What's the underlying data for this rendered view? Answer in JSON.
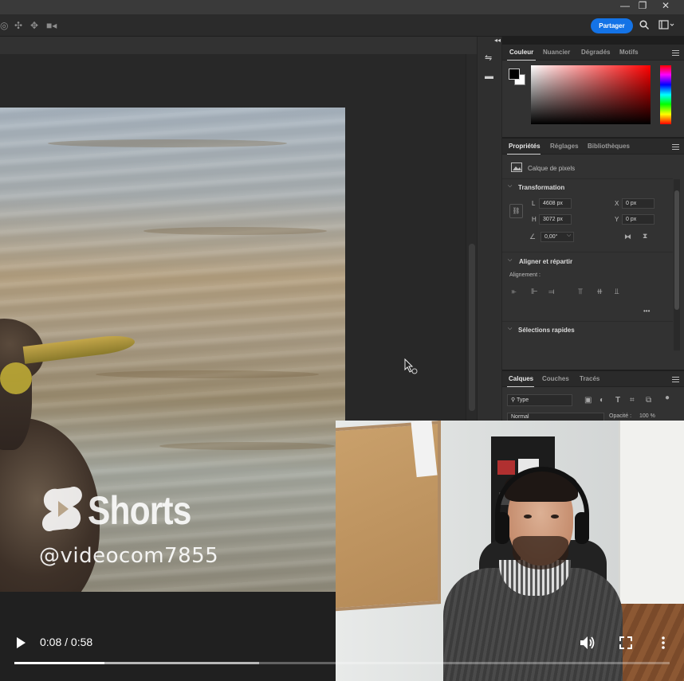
{
  "window": {
    "controls": [
      "—",
      "❐",
      "✕"
    ]
  },
  "header": {
    "share_label": "Partager"
  },
  "color_panel": {
    "tabs": [
      {
        "label": "Couleur",
        "active": true
      },
      {
        "label": "Nuancier",
        "active": false
      },
      {
        "label": "Dégradés",
        "active": false
      },
      {
        "label": "Motifs",
        "active": false
      }
    ],
    "foreground": "#000000",
    "background": "#ffffff",
    "field_hue": "#ff0000"
  },
  "properties_panel": {
    "tabs": [
      {
        "label": "Propriétés",
        "active": true
      },
      {
        "label": "Réglages",
        "active": false
      },
      {
        "label": "Bibliothèques",
        "active": false
      }
    ],
    "layer_type": "Calque de pixels",
    "transform": {
      "title": "Transformation",
      "width_label": "L",
      "width_value": "4608 px",
      "height_label": "H",
      "height_value": "3072 px",
      "x_label": "X",
      "x_value": "0 px",
      "y_label": "Y",
      "y_value": "0 px",
      "angle_value": "0,00°"
    },
    "align": {
      "title": "Aligner et répartir",
      "subtitle": "Alignement :",
      "more": "•••"
    },
    "quick_actions": {
      "title": "Sélections rapides"
    }
  },
  "layers_panel": {
    "tabs": [
      {
        "label": "Calques",
        "active": true
      },
      {
        "label": "Couches",
        "active": false
      },
      {
        "label": "Tracés",
        "active": false
      }
    ],
    "filter_label": "Type",
    "blend_mode": "Normal",
    "opacity_label": "Opacité :",
    "opacity_value": "100 %"
  },
  "overlay": {
    "brand": "Shorts",
    "handle": "@videocom7855"
  },
  "player": {
    "current_time": "0:08",
    "duration": "0:58",
    "time_display": "0:08 / 0:58",
    "progress_fraction": 0.138,
    "buffered_fraction": 0.373
  }
}
